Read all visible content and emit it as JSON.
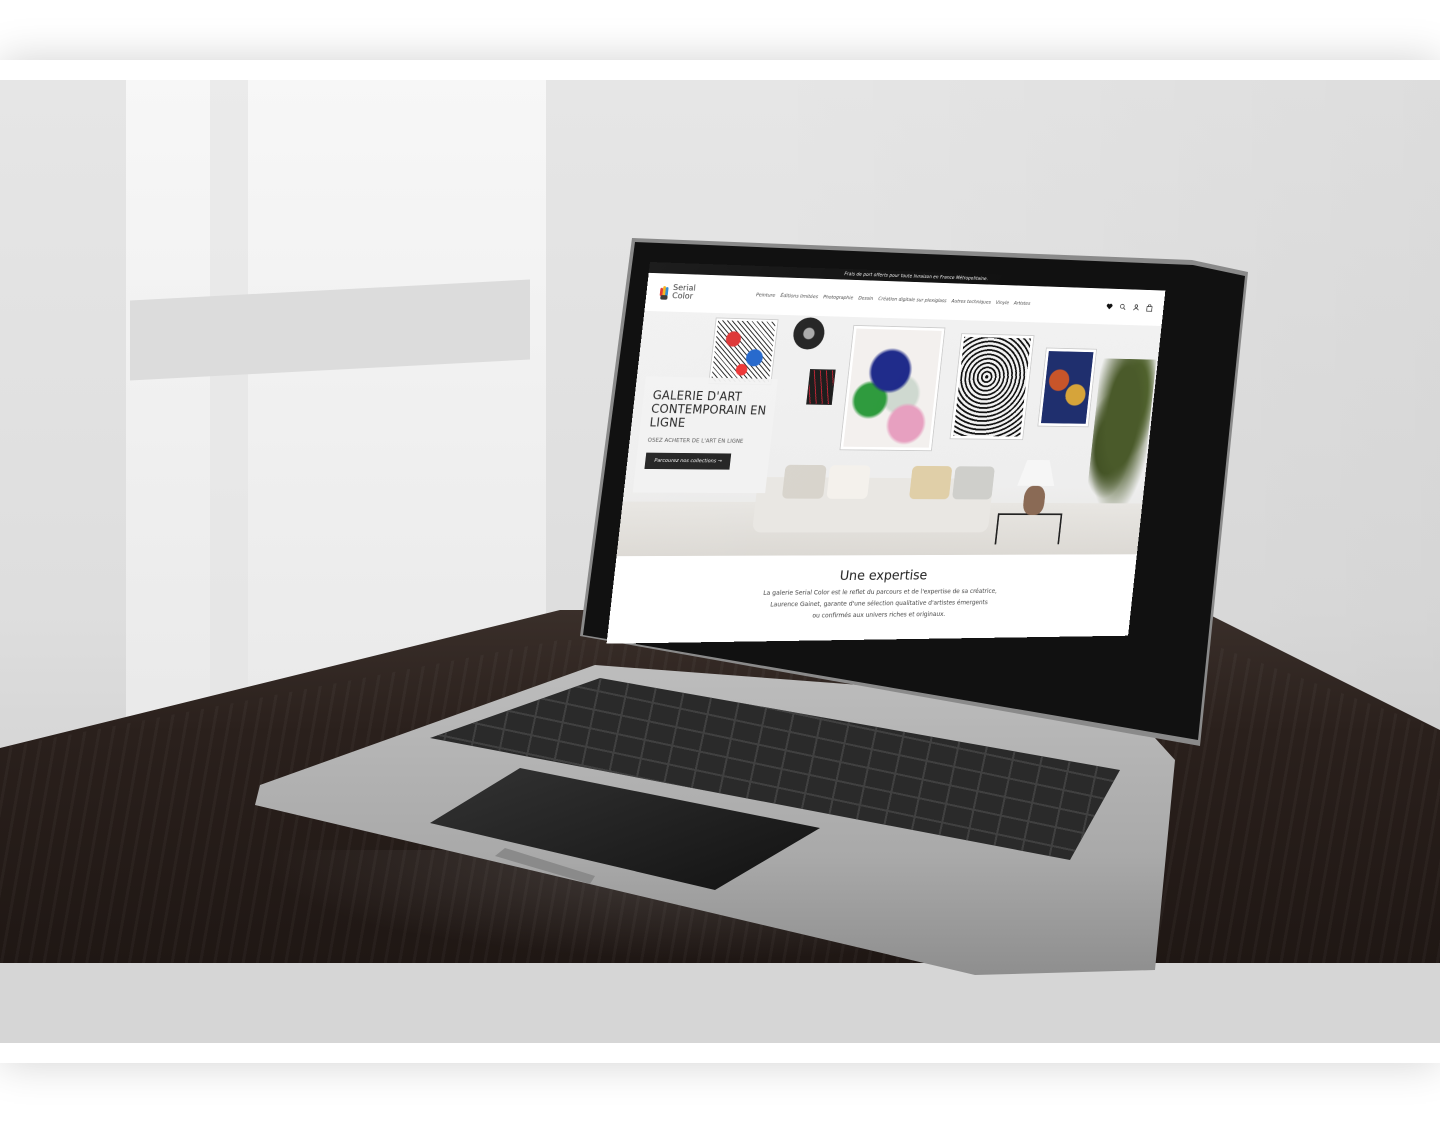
{
  "site": {
    "announcement": "Frais de port offerts pour toute livraison en France Métropolitaine.",
    "logo": {
      "line1": "Serial",
      "line2": "Color"
    },
    "nav": [
      "Peinture",
      "Éditions limitées",
      "Photographie",
      "Dessin",
      "Création digitale sur plexiglass",
      "Autres techniques",
      "Vinyle",
      "Artistes"
    ],
    "icons": [
      "heart-icon",
      "search-icon",
      "account-icon",
      "cart-icon"
    ],
    "hero": {
      "title": "GALERIE D'ART CONTEMPORAIN EN LIGNE",
      "subtitle": "OSEZ ACHETER DE L'ART EN LIGNE",
      "button": "Parcourez nos collections →"
    },
    "expertise": {
      "title": "Une expertise",
      "line1": "La galerie Serial Color est le reflet du parcours et de l'expertise de sa créatrice,",
      "line2": "Laurence Gainet, garante d'une sélection qualitative d'artistes émergents",
      "line3": "ou confirmés aux univers riches et originaux."
    }
  },
  "colors": {
    "announcement_bg": "#111111",
    "button_bg": "#222222",
    "table": "#2a201c",
    "laptop": "#a9a9a9"
  }
}
